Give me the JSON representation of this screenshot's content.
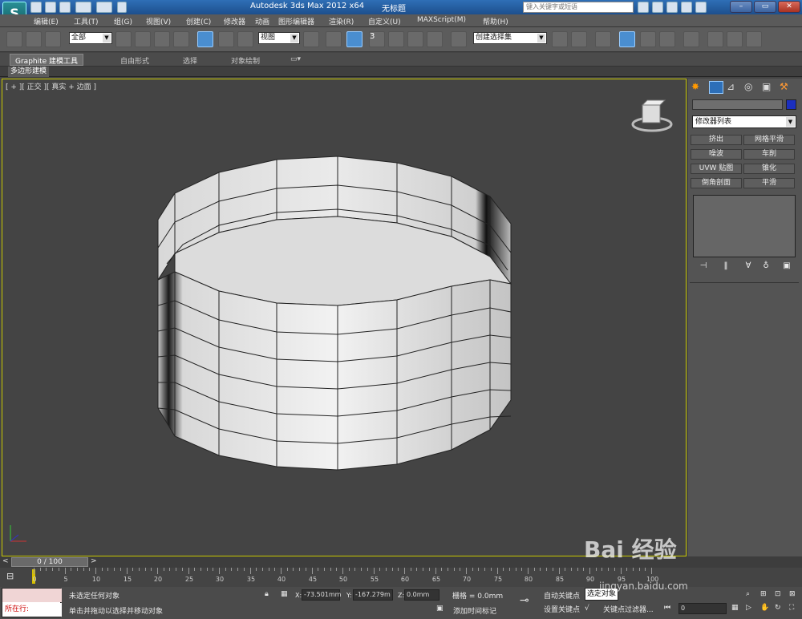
{
  "title_bar": {
    "app_title": "Autodesk 3ds Max  2012 x64",
    "doc_title": "无标题",
    "search_placeholder": "键入关键字或短语"
  },
  "menu": [
    "编辑(E)",
    "工具(T)",
    "组(G)",
    "视图(V)",
    "创建(C)",
    "修改器",
    "动画",
    "图形编辑器",
    "渲染(R)",
    "自定义(U)",
    "MAXScript(M)",
    "帮助(H)"
  ],
  "toolbar": {
    "selection_filter": "全部",
    "coord_system": "视图",
    "named_selection": "创建选择集",
    "snap_value": "3"
  },
  "ribbon": {
    "tabs": [
      "Graphite 建模工具",
      "自由形式",
      "选择",
      "对象绘制"
    ],
    "subtab": "多边形建模"
  },
  "viewport": {
    "label": "[ + ][ 正交 ][ 真实 + 边面 ]"
  },
  "command_panel": {
    "modifier_list": "修改器列表",
    "buttons": [
      "挤出",
      "网格平滑",
      "噪波",
      "车削",
      "UVW 贴图",
      "锥化",
      "倒角剖面",
      "平滑"
    ]
  },
  "timeline": {
    "frame_display": "0 / 100",
    "ticks": [
      "0",
      "5",
      "10",
      "15",
      "20",
      "25",
      "30",
      "35",
      "40",
      "45",
      "50",
      "55",
      "60",
      "65",
      "70",
      "75",
      "80",
      "85",
      "90",
      "95",
      "100"
    ]
  },
  "status": {
    "maxscript_text": "所在行:",
    "selection_status": "未选定任何对象",
    "prompt": "单击并拖动以选择并移动对象",
    "x_label": "X:",
    "x_value": "-73.501mm",
    "y_label": "Y:",
    "y_value": "-167.279m",
    "z_label": "Z:",
    "z_value": "0.0mm",
    "grid": "栅格 = 0.0mm",
    "add_time_tag": "添加时间标记",
    "auto_key": "自动关键点",
    "set_key": "设置关键点",
    "selected_objects": "选定对象",
    "key_filters": "关键点过滤器...",
    "current_frame": "0"
  },
  "watermark": {
    "brand": "Bai  经验",
    "url": "jingyan.baidu.com"
  },
  "colors": {
    "viewport_bg": "#444444",
    "active_border": "#c8c800",
    "title_blue": "#2f6fb6"
  }
}
